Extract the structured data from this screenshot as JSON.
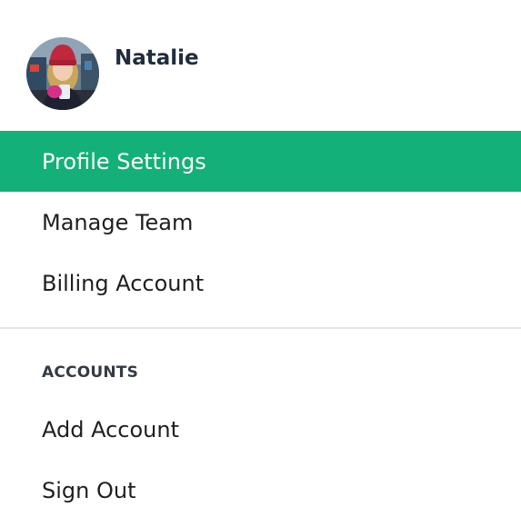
{
  "user": {
    "name": "Natalie",
    "avatar_icon": "user-photo-avatar"
  },
  "menu": {
    "items": [
      {
        "label": "Profile Settings",
        "active": true
      },
      {
        "label": "Manage Team",
        "active": false
      },
      {
        "label": "Billing Account",
        "active": false
      }
    ]
  },
  "accounts_section": {
    "heading": "ACCOUNTS",
    "items": [
      {
        "label": "Add Account"
      },
      {
        "label": "Sign Out"
      }
    ]
  },
  "colors": {
    "accent": "#13b07a",
    "active_text": "#ffffff",
    "text": "#1f1f1f",
    "divider": "#e4e6ea"
  }
}
